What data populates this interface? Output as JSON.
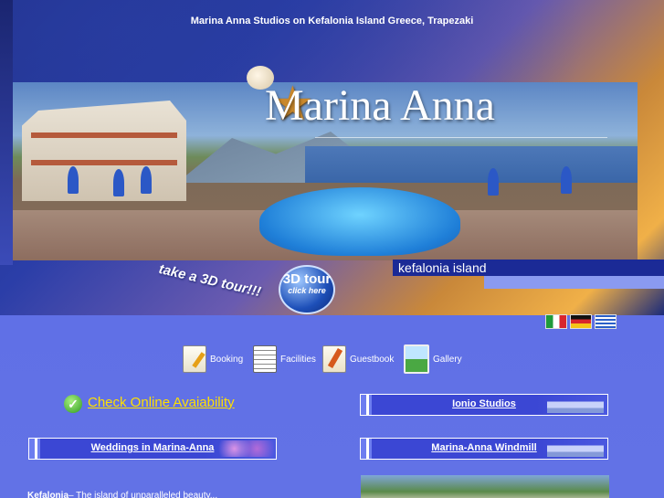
{
  "header": {
    "top_title": "Marina Anna Studios on Kefalonia Island Greece, Trapezaki",
    "logo_text": "Marina Anna",
    "region_label": "kefalonia island",
    "tour_prompt": "take a 3D tour!!!",
    "tour_badge_big": "3D tour",
    "tour_badge_small": "click here"
  },
  "languages": [
    {
      "code": "it",
      "icon": "italian-flag-icon"
    },
    {
      "code": "de",
      "icon": "german-flag-icon"
    },
    {
      "code": "gr",
      "icon": "greek-flag-icon"
    }
  ],
  "menu": [
    {
      "label": "Booking",
      "icon": "booking-icon"
    },
    {
      "label": "Facilities",
      "icon": "facilities-icon"
    },
    {
      "label": "Guestbook",
      "icon": "guestbook-icon"
    },
    {
      "label": "Gallery",
      "icon": "gallery-icon"
    }
  ],
  "availability": {
    "label": "Check Online Avaiability",
    "icon": "checkmark-icon"
  },
  "links": {
    "ionio": "Ionio Studios",
    "weddings": "Weddings in Marina-Anna",
    "windmill": "Marina-Anna Windmill"
  },
  "intro": {
    "heading": "Kefalonia",
    "text": "– The island of unparalleled beauty..."
  },
  "colors": {
    "page_bg": "#5f6fe2",
    "link_yellow": "#ffe000",
    "box_blue": "#3b47d4"
  }
}
